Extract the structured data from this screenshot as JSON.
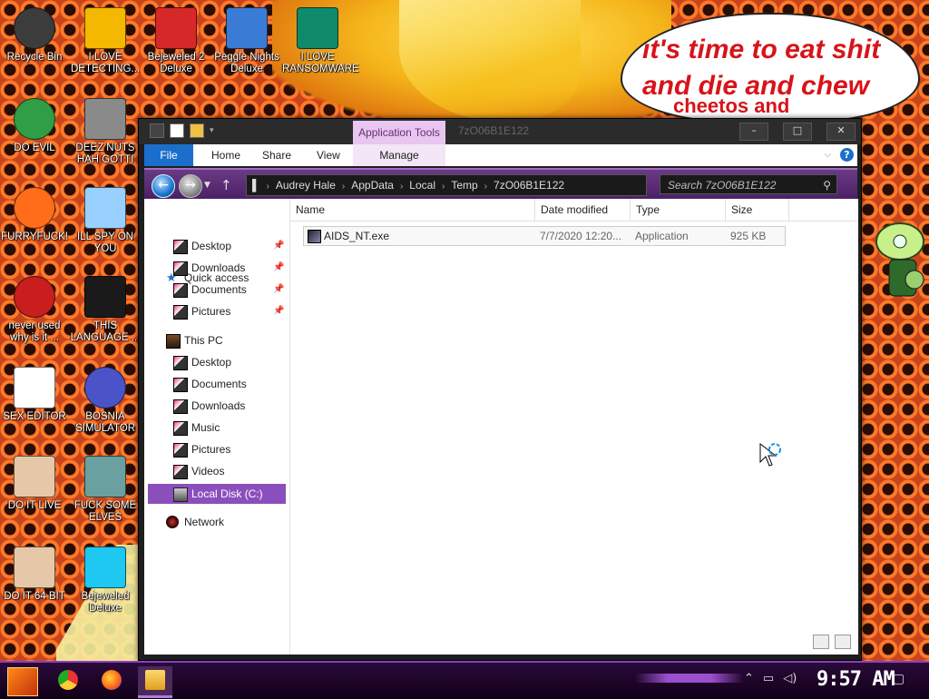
{
  "wallpaper": {
    "speech_lines": [
      "it's time to eat shit",
      "and die and chew",
      "cheetos and"
    ]
  },
  "desktop_icons": [
    {
      "label": "Recycle Bin",
      "icon": "recycle-bin-icon",
      "color": "#3c3c3c"
    },
    {
      "label": "I LOVE DETECTING...",
      "icon": "detect-it-easy-icon",
      "color": "#f5b800"
    },
    {
      "label": "Bejeweled 2 Deluxe",
      "icon": "bejeweled-2-icon",
      "color": "#d62828"
    },
    {
      "label": "Peggle Nights Deluxe",
      "icon": "peggle-nights-icon",
      "color": "#3a7bd5"
    },
    {
      "label": "I LOVE RANSOMWARE",
      "icon": "publisher-icon",
      "color": "#0f8a6a"
    },
    {
      "label": "DO EVIL",
      "icon": "chrome-icon",
      "color": "#2f9e44"
    },
    {
      "label": "DEEZ NUTS HAH GOTTI",
      "icon": "stacked-windows-icon",
      "color": "#8a8a8a"
    },
    {
      "label": "FURRYFUCK!",
      "icon": "firefox-icon",
      "color": "#ff6d1a"
    },
    {
      "label": "ILL SPY ON YOU",
      "icon": "network-spy-icon",
      "color": "#9ad0ff"
    },
    {
      "label": "never used why is it ...",
      "icon": "dev-cpp-icon",
      "color": "#c81e1e"
    },
    {
      "label": "THIS LANGUAGE ...",
      "icon": "goland-icon",
      "color": "#1a1a1a"
    },
    {
      "label": "SEX EDITOR",
      "icon": "hxd-icon",
      "color": "#ffffff"
    },
    {
      "label": "BOSNIA SIMULATOR",
      "icon": "virus-ball-icon",
      "color": "#4a54c8"
    },
    {
      "label": "DO IT LIVE",
      "icon": "portrait-icon",
      "color": "#e6c8a8"
    },
    {
      "label": "FUCK SOME ELVES",
      "icon": "elf-portrait-icon",
      "color": "#6aa0a0"
    },
    {
      "label": "DO IT 64 BIT",
      "icon": "portrait-64-icon",
      "color": "#e6c8a8"
    },
    {
      "label": "Bejeweled Deluxe",
      "icon": "diamond-icon",
      "color": "#1ec8f0"
    }
  ],
  "window": {
    "title": "7zO06B1E122",
    "app_tools_label": "Application Tools",
    "minimize": "–",
    "maximize": "□",
    "close": "✕",
    "ribbon_tabs": [
      "File",
      "Home",
      "Share",
      "View",
      "Manage"
    ],
    "help": "?",
    "breadcrumb": [
      "Audrey Hale",
      "AppData",
      "Local",
      "Temp",
      "7zO06B1E122"
    ],
    "search_placeholder": "Search 7zO06B1E122",
    "nav": {
      "quick_access": "Quick access",
      "quick_items": [
        "Desktop",
        "Downloads",
        "Documents",
        "Pictures"
      ],
      "this_pc": "This PC",
      "pc_items": [
        "Desktop",
        "Documents",
        "Downloads",
        "Music",
        "Pictures",
        "Videos"
      ],
      "local_disk": "Local Disk (C:)",
      "network": "Network"
    },
    "columns": [
      "Name",
      "Date modified",
      "Type",
      "Size"
    ],
    "files": [
      {
        "name": "AIDS_NT.exe",
        "date": "7/7/2020 12:20...",
        "type": "Application",
        "size": "925 KB"
      }
    ]
  },
  "taskbar": {
    "clock": "9:57 AM"
  },
  "colors": {
    "accent": "#8b4fbd",
    "file_tab": "#1b6fcc",
    "app_tools": "#e8c6ef"
  }
}
